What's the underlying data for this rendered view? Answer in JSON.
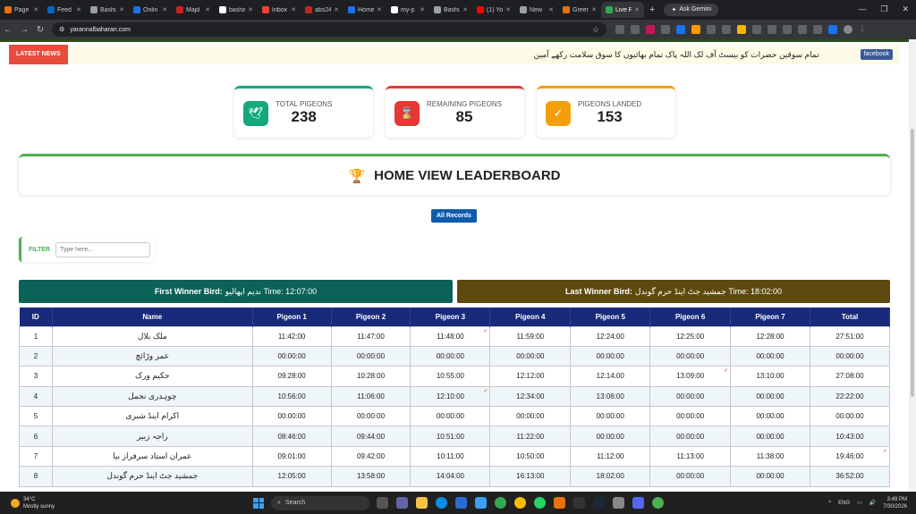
{
  "browser": {
    "tabs": [
      {
        "label": "Page",
        "color": "#e8710a"
      },
      {
        "label": "Feed",
        "color": "#0a66c2"
      },
      {
        "label": "Bashi",
        "color": "#9aa0a6"
      },
      {
        "label": "Onlin",
        "color": "#1a73e8"
      },
      {
        "label": "Majd",
        "color": "#c5221f"
      },
      {
        "label": "basha",
        "color": "#ffffff"
      },
      {
        "label": "Inbox",
        "color": "#ea4335"
      },
      {
        "label": "abs24",
        "color": "#c5221f"
      },
      {
        "label": "Home",
        "color": "#1a73e8"
      },
      {
        "label": "my-p",
        "color": "#ffffff"
      },
      {
        "label": "Bashi",
        "color": "#9aa0a6"
      },
      {
        "label": "(1) Yo",
        "color": "#ff0000"
      },
      {
        "label": "New",
        "color": "#9aa0a6"
      },
      {
        "label": "Greer",
        "color": "#e8710a"
      },
      {
        "label": "Live R",
        "color": "#34a853"
      }
    ],
    "ask_gemini": "Ask Gemini",
    "url": "yarannalbaharan.com"
  },
  "news": {
    "label": "LATEST NEWS",
    "text": "تمام سوقین حضرات کو بیسٹ آف لک اللہ پاک تمام بھائیوں کا سوق سلامت رکھے آمین",
    "facebook": "facebook"
  },
  "stats": [
    {
      "label": "TOTAL PIGEONS",
      "value": "238",
      "color": "#15a77e",
      "icon": "🕊"
    },
    {
      "label": "REMAINING PIGEONS",
      "value": "85",
      "color": "#e53935",
      "icon": "⌛"
    },
    {
      "label": "PIGEONS LANDED",
      "value": "153",
      "color": "#f59e0b",
      "icon": "✓"
    }
  ],
  "leaderboard_title": "HOME VIEW LEADERBOARD",
  "all_records": "All Records",
  "filter": {
    "label": "FILTER",
    "placeholder": "Type here..."
  },
  "winners": {
    "first_label": "First Winner Bird:",
    "first_text": "ندیم اپھالیو Time: 12:07:00",
    "last_label": "Last Winner Bird:",
    "last_text": "جمشید جٹ اینڈ حرم گوندل Time: 18:02:00"
  },
  "table": {
    "headers": [
      "ID",
      "Name",
      "Pigeon 1",
      "Pigeon 2",
      "Pigeon 3",
      "Pigeon 4",
      "Pigeon 5",
      "Pigeon 6",
      "Pigeon 7",
      "Total"
    ],
    "rows": [
      {
        "id": "1",
        "name": "ملک بلال",
        "cells": [
          "11:42:00",
          "11:47:00",
          "11:48:00",
          "11:59:00",
          "12:24:00",
          "12:25:00",
          "12:28:00",
          "27:51:00"
        ]
      },
      {
        "id": "2",
        "name": "عمر وڑائچ",
        "cells": [
          "00:00:00",
          "00:00:00",
          "00:00:00",
          "00:00:00",
          "00:00:00",
          "00:00:00",
          "00:00:00",
          "00:00:00"
        ]
      },
      {
        "id": "3",
        "name": "حکیم ورک",
        "cells": [
          "09:28:00",
          "10:28:00",
          "10:55:00",
          "12:12:00",
          "12:14:00",
          "13:09:00",
          "13:10:00",
          "27:08:00"
        ]
      },
      {
        "id": "4",
        "name": "چوہدری نجمل",
        "cells": [
          "10:56:00",
          "11:06:00",
          "12:10:00",
          "12:34:00",
          "13:06:00",
          "00:00:00",
          "00:00:00",
          "22:22:00"
        ]
      },
      {
        "id": "5",
        "name": "اکرام اینڈ شبری",
        "cells": [
          "00:00:00",
          "00:00:00",
          "00:00:00",
          "00:00:00",
          "00:00:00",
          "00:00:00",
          "00:00:00",
          "00:00:00"
        ]
      },
      {
        "id": "6",
        "name": "راجہ زبیر",
        "cells": [
          "08:46:00",
          "09:44:00",
          "10:51:00",
          "11:22:00",
          "00:00:00",
          "00:00:00",
          "00:00:00",
          "10:43:00"
        ]
      },
      {
        "id": "7",
        "name": "عمران استاد سرفراز بیا",
        "cells": [
          "09:01:00",
          "09:42:00",
          "10:11:00",
          "10:50:00",
          "11:12:00",
          "11:13:00",
          "11:38:00",
          "19:46:00"
        ]
      },
      {
        "id": "8",
        "name": "جمشید جٹ اینڈ حرم گوندل",
        "cells": [
          "12:05:00",
          "13:58:00",
          "14:04:00",
          "16:13:00",
          "18:02:00",
          "00:00:00",
          "00:00:00",
          "36:52:00"
        ]
      }
    ]
  },
  "taskbar": {
    "temp": "34°C",
    "weather": "Mostly sunny",
    "search": "Search",
    "lang": "ENG",
    "time": "3:49 PM",
    "date": "7/30/2026"
  }
}
